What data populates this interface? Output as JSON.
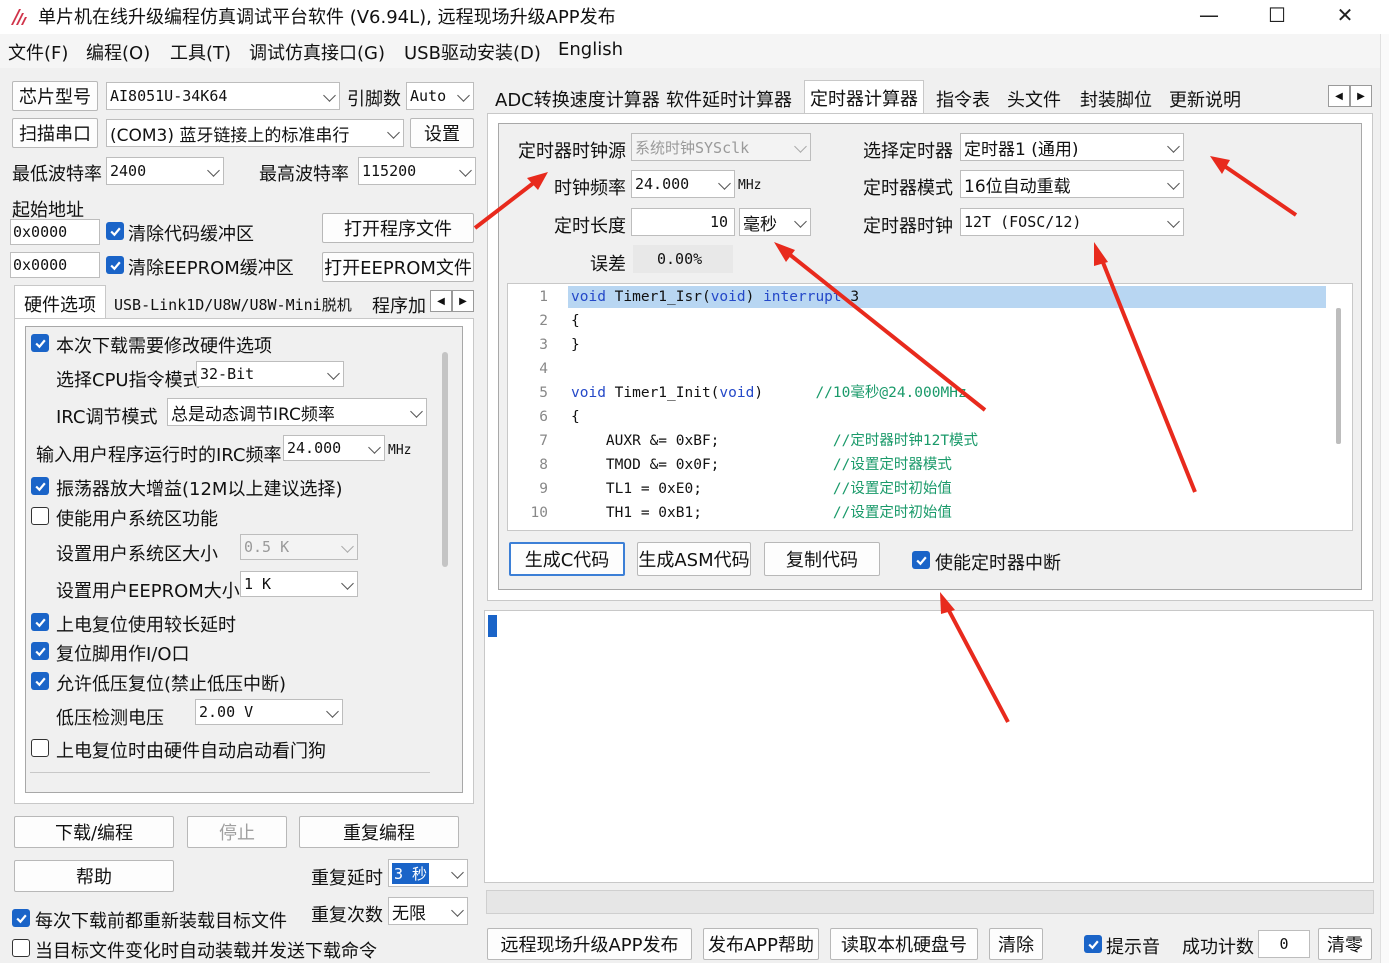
{
  "window": {
    "title": "单片机在线升级编程仿真调试平台软件 (V6.94L), 远程现场升级APP发布",
    "minimize_glyph": "—",
    "maximize_glyph": "☐",
    "close_glyph": "✕"
  },
  "menu": [
    "文件(F)",
    "编程(O)",
    "工具(T)",
    "调试仿真接口(G)",
    "USB驱动安装(D)",
    "English"
  ],
  "left": {
    "chip_btn": "芯片型号",
    "chip_value": "AI8051U-34K64",
    "pin_label": "引脚数",
    "pin_value": "Auto",
    "scan_btn": "扫描串口",
    "port_value": "(COM3) 蓝牙链接上的标准串行",
    "settings_btn": "设置",
    "min_baud_label": "最低波特率",
    "min_baud_value": "2400",
    "max_baud_label": "最高波特率",
    "max_baud_value": "115200",
    "start_addr_label": "起始地址",
    "addr1": "0x0000",
    "clear_code_label": "清除代码缓冲区",
    "open_prog_btn": "打开程序文件",
    "addr2": "0x0000",
    "clear_eeprom_label": "清除EEPROM缓冲区",
    "open_eeprom_btn": "打开EEPROM文件",
    "tabs": [
      "硬件选项",
      "USB-Link1D/U8W/U8W-Mini脱机",
      "程序加"
    ],
    "hw": {
      "modify_hw": "本次下载需要修改硬件选项",
      "cpu_mode_label": "选择CPU指令模式",
      "cpu_mode_value": "32-Bit",
      "irc_label": "IRC调节模式",
      "irc_value": "总是动态调节IRC频率",
      "freq_label": "输入用户程序运行时的IRC频率",
      "freq_value": "24.000",
      "freq_unit": "MHz",
      "osc_gain": "振荡器放大增益(12M以上建议选择)",
      "user_sys": "使能用户系统区功能",
      "user_sys_size_label": "设置用户系统区大小",
      "user_sys_size_value": "0.5 K",
      "eeprom_size_label": "设置用户EEPROM大小",
      "eeprom_size_value": "1   K",
      "long_delay": "上电复位使用较长延时",
      "reset_io": "复位脚用作I/O口",
      "lvr": "允许低压复位(禁止低压中断)",
      "lv_label": "低压检测电压",
      "lv_value": "2.00 V",
      "wdt": "上电复位时由硬件自动启动看门狗"
    },
    "download_btn": "下载/编程",
    "stop_btn": "停止",
    "reprog_btn": "重复编程",
    "help_btn": "帮助",
    "repeat_delay_label": "重复延时",
    "repeat_delay_value": "3 秒",
    "repeat_count_label": "重复次数",
    "repeat_count_value": "无限",
    "reload_label": "每次下载前都重新装载目标文件",
    "auto_load_label": "当目标文件变化时自动装载并发送下载命令"
  },
  "right": {
    "tabs": [
      "ADC转换速度计算器",
      "软件延时计算器",
      "定时器计算器",
      "指令表",
      "头文件",
      "封装脚位",
      "更新说明"
    ],
    "active_tab": "定时器计算器",
    "timer": {
      "clk_src_label": "定时器时钟源",
      "clk_src_value": "系统时钟SYSclk",
      "freq_label": "时钟频率",
      "freq_value": "24.000",
      "freq_unit": "MHz",
      "length_label": "定时长度",
      "length_value": "10",
      "length_unit": "毫秒",
      "error_label": "误差",
      "error_value": "0.00%",
      "select_label": "选择定时器",
      "select_value": "定时器1 (通用)",
      "mode_label": "定时器模式",
      "mode_value": "16位自动重载",
      "clock_label": "定时器时钟",
      "clock_value": "12T (FOSC/12)"
    },
    "code_lines": [
      {
        "n": "1",
        "kw": "void",
        "rest": " Timer1_Isr(",
        "kw2": "void",
        "rest2": ") ",
        "kw3": "interrupt",
        "rest3": " 3",
        "cm": ""
      },
      {
        "n": "2",
        "kw": "",
        "rest": "{",
        "kw2": "",
        "rest2": "",
        "kw3": "",
        "rest3": "",
        "cm": ""
      },
      {
        "n": "3",
        "kw": "",
        "rest": "}",
        "kw2": "",
        "rest2": "",
        "kw3": "",
        "rest3": "",
        "cm": ""
      },
      {
        "n": "4",
        "kw": "",
        "rest": "",
        "kw2": "",
        "rest2": "",
        "kw3": "",
        "rest3": "",
        "cm": ""
      },
      {
        "n": "5",
        "kw": "void",
        "rest": " Timer1_Init(",
        "kw2": "void",
        "rest2": ")      ",
        "kw3": "",
        "rest3": "",
        "cm": "//10毫秒@24.000MHz"
      },
      {
        "n": "6",
        "kw": "",
        "rest": "{",
        "kw2": "",
        "rest2": "",
        "kw3": "",
        "rest3": "",
        "cm": ""
      },
      {
        "n": "7",
        "kw": "",
        "rest": "    AUXR &= 0xBF;             ",
        "kw2": "",
        "rest2": "",
        "kw3": "",
        "rest3": "",
        "cm": "//定时器时钟12T模式"
      },
      {
        "n": "8",
        "kw": "",
        "rest": "    TMOD &= 0x0F;             ",
        "kw2": "",
        "rest2": "",
        "kw3": "",
        "rest3": "",
        "cm": "//设置定时器模式"
      },
      {
        "n": "9",
        "kw": "",
        "rest": "    TL1 = 0xE0;               ",
        "kw2": "",
        "rest2": "",
        "kw3": "",
        "rest3": "",
        "cm": "//设置定时初始值"
      },
      {
        "n": "10",
        "kw": "",
        "rest": "    TH1 = 0xB1;               ",
        "kw2": "",
        "rest2": "",
        "kw3": "",
        "rest3": "",
        "cm": "//设置定时初始值"
      }
    ],
    "gen_c_btn": "生成C代码",
    "gen_asm_btn": "生成ASM代码",
    "copy_btn": "复制代码",
    "enable_int_label": "使能定时器中断",
    "publish_btn": "远程现场升级APP发布",
    "publish_help_btn": "发布APP帮助",
    "read_disk_btn": "读取本机硬盘号",
    "clear_btn": "清除",
    "beep_label": "提示音",
    "success_label": "成功计数",
    "success_value": "0",
    "reset_count_btn": "清零"
  },
  "annotation_color": "#e82a1d"
}
